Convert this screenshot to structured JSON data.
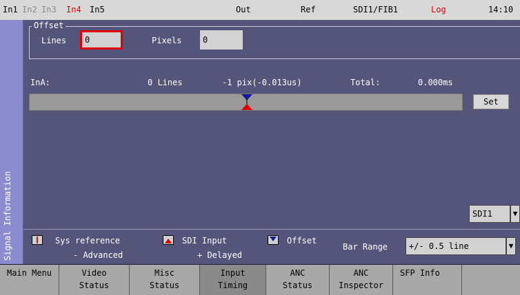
{
  "status_bar": {
    "inputs": [
      {
        "label": "In1",
        "color": "#000000"
      },
      {
        "label": "In2",
        "color": "#8a8a8a"
      },
      {
        "label": "In3",
        "color": "#8a8a8a"
      },
      {
        "label": "In4",
        "color": "#e00000"
      },
      {
        "label": "In5",
        "color": "#000000"
      }
    ],
    "out": "Out",
    "ref": "Ref",
    "source": "SDI1/FIB1",
    "log": "Log",
    "log_color": "#e00000",
    "time": "14:10"
  },
  "side_tab": {
    "label": "Signal Information"
  },
  "offset": {
    "title": "Offset",
    "lines_label": "Lines",
    "lines_value": "0",
    "pixels_label": "Pixels",
    "pixels_value": "0"
  },
  "timing": {
    "input": "InA:",
    "lines": "0 Lines",
    "pix": "-1 pix(-0.013us)",
    "total_label": "Total:",
    "total_value": "0.000ms",
    "set_label": "Set"
  },
  "source_select": {
    "value": "SDI1"
  },
  "legend": {
    "sys_reference": "Sys reference",
    "sdi_input": "SDI Input",
    "offset": "Offset",
    "advanced": "- Advanced",
    "delayed": "+ Delayed"
  },
  "bar_range": {
    "label": "Bar Range",
    "value": "+/- 0.5 line"
  },
  "menu": {
    "items": [
      {
        "line1": "Main Menu",
        "line2": ""
      },
      {
        "line1": "Video",
        "line2": "Status"
      },
      {
        "line1": "Misc",
        "line2": "Status"
      },
      {
        "line1": "Input",
        "line2": "Timing"
      },
      {
        "line1": "ANC",
        "line2": "Status"
      },
      {
        "line1": "ANC",
        "line2": "Inspector"
      },
      {
        "line1": "SFP Info",
        "line2": ""
      },
      {
        "line1": "",
        "line2": ""
      }
    ]
  },
  "colors": {
    "panel": "#55557b",
    "side_tab": "#8b8bd0",
    "offset_marker": "#1a1aa0",
    "sdi_marker": "#e00000",
    "sys_marker": "#c02020",
    "focus_border": "#e00000"
  }
}
